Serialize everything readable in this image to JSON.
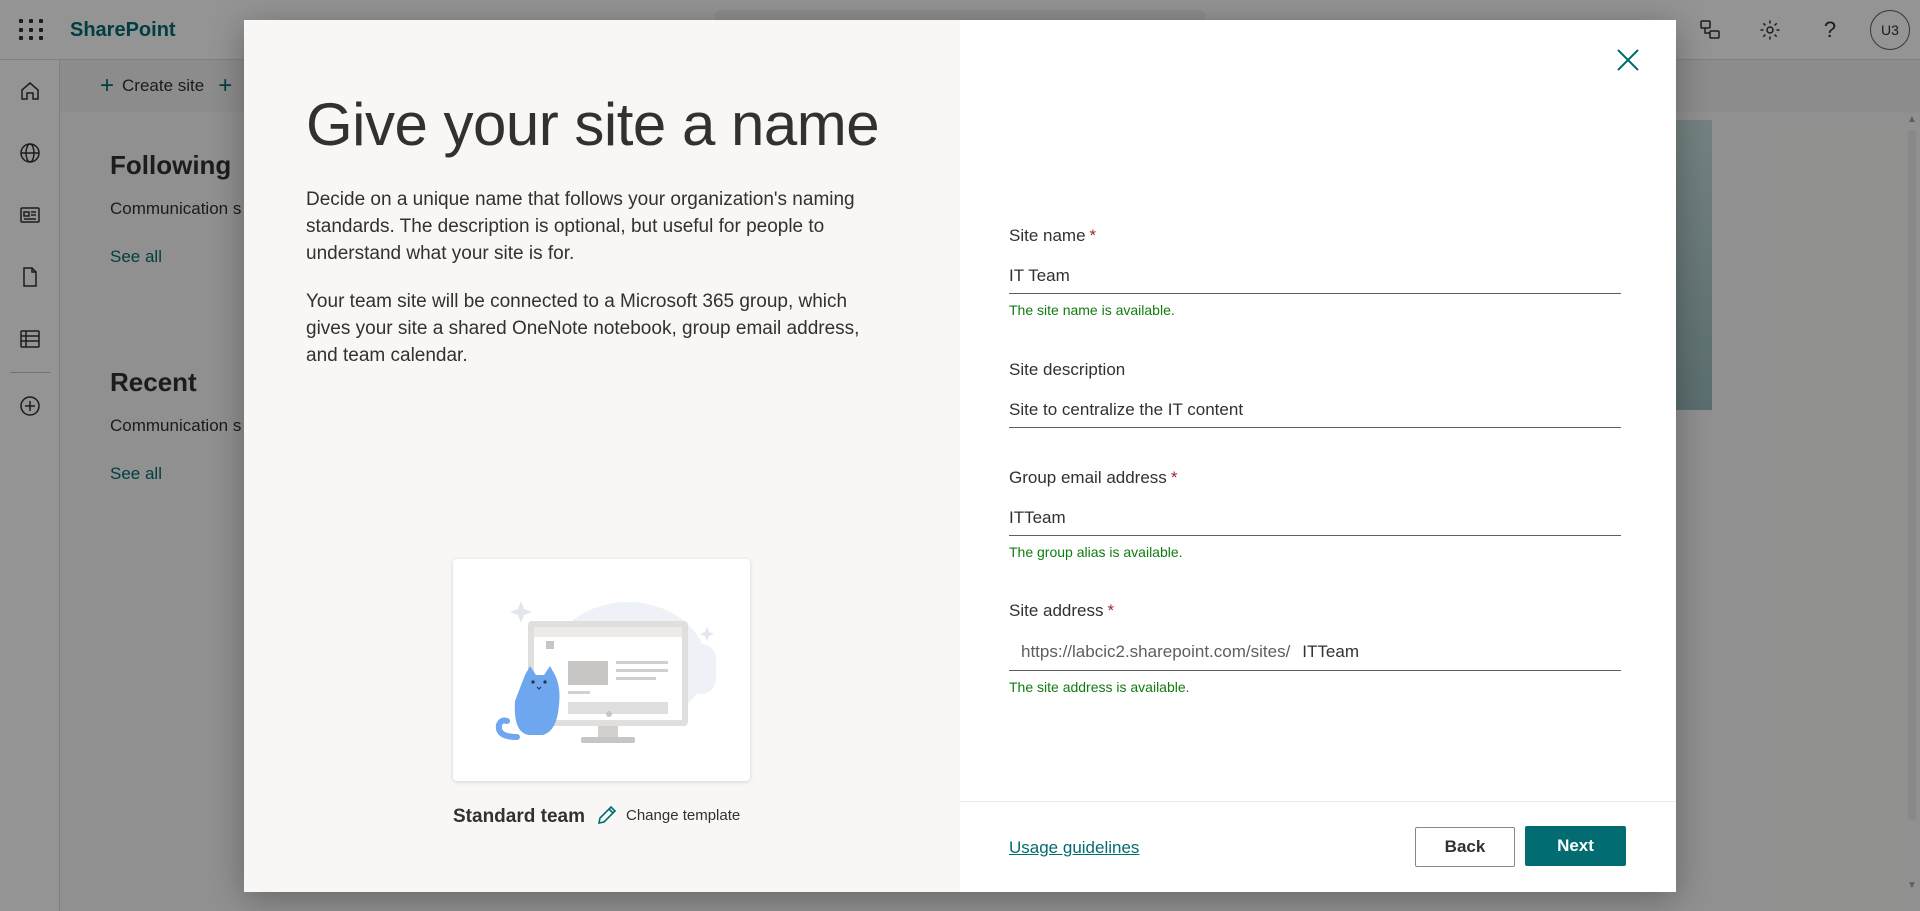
{
  "app": {
    "brand": "SharePoint",
    "avatar_initials": "U3"
  },
  "commandbar": {
    "create_site": "Create site"
  },
  "background": {
    "following_title": "Following",
    "following_item": "Communication s",
    "following_see_all": "See all",
    "recent_title": "Recent",
    "recent_item": "Communication s",
    "recent_see_all": "See all"
  },
  "dialog": {
    "title": "Give your site a name",
    "description_1": "Decide on a unique name that follows your organization's naming standards. The description is optional, but useful for people to understand what your site is for.",
    "description_2": "Your team site will be connected to a Microsoft 365 group, which gives your site a shared OneNote notebook, group email address, and team calendar.",
    "template_name": "Standard team",
    "change_template": "Change template",
    "fields": {
      "site_name": {
        "label": "Site name",
        "required": "*",
        "value": "IT Team",
        "message": "The site name is available."
      },
      "site_description": {
        "label": "Site description",
        "value": "Site to centralize the IT content"
      },
      "group_email": {
        "label": "Group email address",
        "required": "*",
        "value": "ITTeam",
        "message": "The group alias is available."
      },
      "site_address": {
        "label": "Site address",
        "required": "*",
        "prefix": "https://labcic2.sharepoint.com/sites/",
        "value": "ITTeam",
        "message": "The site address is available."
      }
    },
    "footer": {
      "usage_guidelines": "Usage guidelines",
      "back": "Back",
      "next": "Next"
    }
  },
  "colors": {
    "accent": "#036c70",
    "success": "#107c10",
    "required": "#a4262c"
  }
}
